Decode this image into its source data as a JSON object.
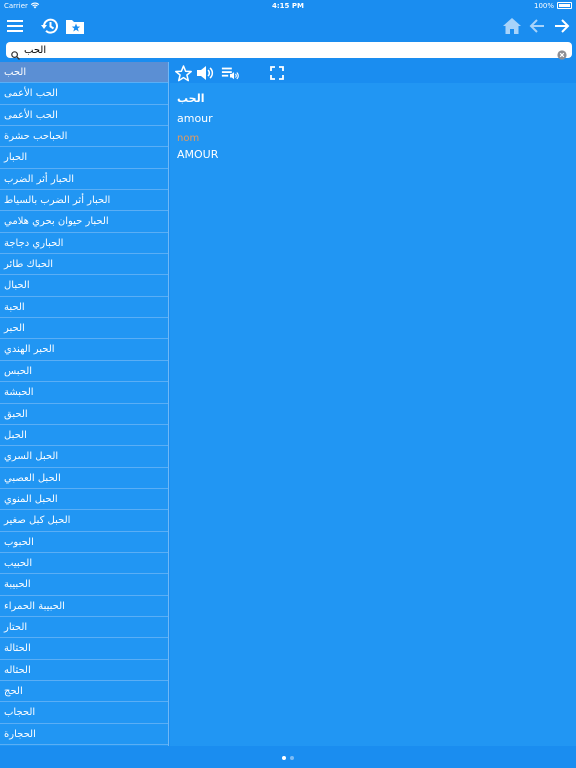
{
  "status_bar": {
    "carrier": "Carrier",
    "time": "4:15 PM",
    "battery": "100%"
  },
  "toolbar": {
    "icons": [
      "menu-icon",
      "history-icon",
      "bookmarks-folder-icon",
      "home-icon",
      "back-arrow-icon",
      "forward-arrow-icon"
    ]
  },
  "search": {
    "value": "الحب",
    "placeholder": ""
  },
  "word_list": [
    "الحب",
    "الحب الأعمى",
    "الحب الأعمى",
    "الحباحب حشرة",
    "الحبار",
    "الحبار أثر الضرب",
    "الحبار أثر الضرب بالسياط",
    "الحبار حيوان بحري هلامي",
    "الحباري دجاجة",
    "الحباك طائر",
    "الحبال",
    "الحبة",
    "الحبر",
    "الحبر الهندي",
    "الحبس",
    "الحبشة",
    "الحبق",
    "الحبل",
    "الحبل السري",
    "الحبل العصبي",
    "الحبل المنوي",
    "الحبل كبل صغير",
    "الحبوب",
    "الحبيب",
    "الحبيبة",
    "الحبيبة الحمراء",
    "الحتار",
    "الحثالة",
    "الحثاله",
    "الحج",
    "الحجاب",
    "الحجارة"
  ],
  "selected_index": 0,
  "detail": {
    "headword": "الحب",
    "translation": "amour",
    "part_of_speech": "nom",
    "translation_upper": "AMOUR",
    "icons": [
      "star-icon",
      "speaker-icon",
      "playlist-audio-icon",
      "fullscreen-icon"
    ]
  },
  "pager": {
    "pages": 2,
    "current": 0
  },
  "colors": {
    "bar": "#1a8df0",
    "panel": "#2196f3",
    "selected_row": "#5b8fd4",
    "pos_text": "#e69a5c"
  }
}
